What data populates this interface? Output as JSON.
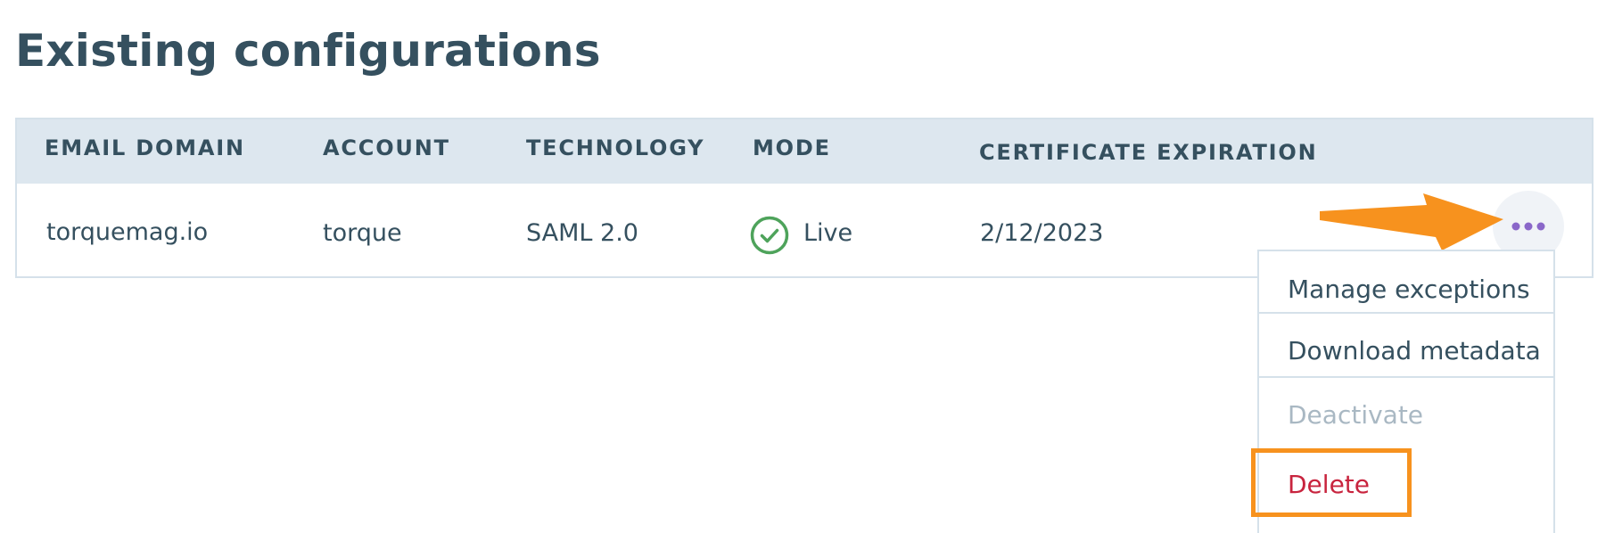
{
  "page": {
    "title": "Existing configurations"
  },
  "table": {
    "headers": {
      "email_domain": "EMAIL DOMAIN",
      "account": "ACCOUNT",
      "technology": "TECHNOLOGY",
      "mode": "MODE",
      "certificate_expiration": "CERTIFICATE EXPIRATION"
    },
    "rows": [
      {
        "email_domain": "torquemag.io",
        "account": "torque",
        "technology": "SAML 2.0",
        "mode": "Live",
        "mode_icon": "check-circle-icon",
        "certificate_expiration": "2/12/2023"
      }
    ]
  },
  "actions_menu": {
    "trigger_icon": "more-horizontal-icon",
    "items": [
      {
        "label": "Manage exceptions",
        "state": "enabled"
      },
      {
        "label": "Download metadata",
        "state": "enabled"
      },
      {
        "label": "Deactivate",
        "state": "disabled"
      },
      {
        "label": "Delete",
        "state": "danger"
      }
    ]
  },
  "annotations": {
    "pointer": "arrow-icon",
    "highlight_target": "Delete"
  },
  "colors": {
    "text": "#35505f",
    "header_bg": "#dde7ef",
    "border": "#d5e1ea",
    "live_green": "#4ea35b",
    "kebab_purple": "#8a67c9",
    "disabled": "#a9b8c3",
    "danger": "#c8243e",
    "annotation_orange": "#f7921e"
  }
}
